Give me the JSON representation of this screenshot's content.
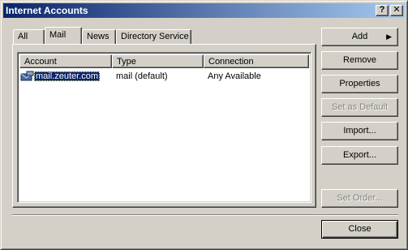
{
  "window": {
    "title": "Internet Accounts",
    "help_label": "?",
    "close_label": "✕"
  },
  "tabs": [
    {
      "label": "All",
      "active": false
    },
    {
      "label": "Mail",
      "active": true
    },
    {
      "label": "News",
      "active": false
    },
    {
      "label": "Directory Service",
      "active": false
    }
  ],
  "list": {
    "columns": [
      "Account",
      "Type",
      "Connection"
    ],
    "rows": [
      {
        "account": "mail.zeuter.com",
        "type": "mail (default)",
        "connection": "Any Available",
        "icon": "mail-account-icon",
        "selected": true
      }
    ]
  },
  "buttons": {
    "add": {
      "label": "Add",
      "arrow": "▶"
    },
    "remove": {
      "label": "Remove"
    },
    "properties": {
      "label": "Properties"
    },
    "set_default": {
      "label": "Set as Default"
    },
    "import": {
      "label": "Import..."
    },
    "export": {
      "label": "Export..."
    },
    "set_order": {
      "label": "Set Order..."
    },
    "close": {
      "label": "Close"
    }
  },
  "colors": {
    "title_bar_start": "#0a246a",
    "title_bar_end": "#a6caf0",
    "selection": "#0a246a",
    "face": "#d4d0c8"
  }
}
